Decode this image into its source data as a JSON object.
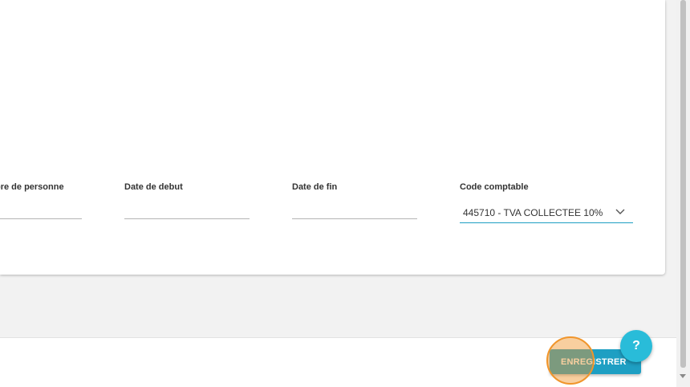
{
  "form": {
    "fields": [
      {
        "label": "bre de personne",
        "value": ""
      },
      {
        "label": "Date de debut",
        "value": ""
      },
      {
        "label": "Date de fin",
        "value": ""
      },
      {
        "label": "Code comptable",
        "value": "445710 - TVA COLLECTEE 10%"
      }
    ]
  },
  "footer": {
    "save_label": "ENREGISTRER",
    "help_label": "?"
  },
  "colors": {
    "accent": "#1e9fc3",
    "help": "#29bcd9",
    "click_marker": "#f0952b"
  }
}
